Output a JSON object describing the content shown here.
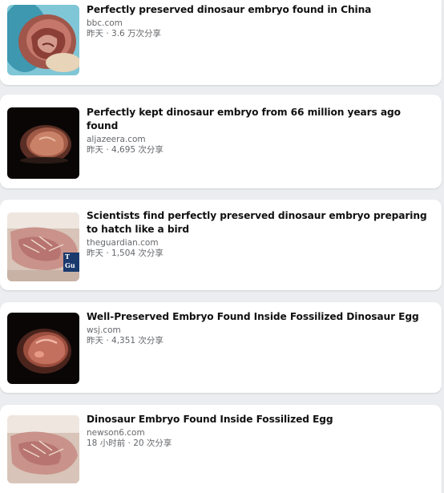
{
  "articles": [
    {
      "title": "Perfectly preserved dinosaur embryo found in China",
      "source": "bbc.com",
      "meta": "昨天 · 3.6 万次分享",
      "thumbnail": "dinosaur-embryo-teal-photo"
    },
    {
      "title": "Perfectly kept dinosaur embryo from 66 million years ago found",
      "source": "aljazeera.com",
      "meta": "昨天 · 4,695 次分享",
      "thumbnail": "dinosaur-embryo-dark-photo"
    },
    {
      "title": "Scientists find perfectly preserved dinosaur embryo preparing to hatch like a bird",
      "source": "theguardian.com",
      "meta": "昨天 · 1,504 次分享",
      "thumbnail": "dinosaur-embryo-fossil-photo",
      "badge": "T Gu"
    },
    {
      "title": "Well-Preserved Embryo Found Inside Fossilized Dinosaur Egg",
      "source": "wsj.com",
      "meta": "昨天 · 4,351 次分享",
      "thumbnail": "dinosaur-embryo-dark-photo"
    },
    {
      "title": "Dinosaur Embryo Found Inside Fossilized Egg",
      "source": "newson6.com",
      "meta": "18 小时前 · 20 次分享",
      "thumbnail": "dinosaur-embryo-fossil-photo"
    }
  ],
  "colors": {
    "background": "#ecedf0",
    "card": "#ffffff",
    "title": "#111111",
    "secondary": "#65676b"
  }
}
